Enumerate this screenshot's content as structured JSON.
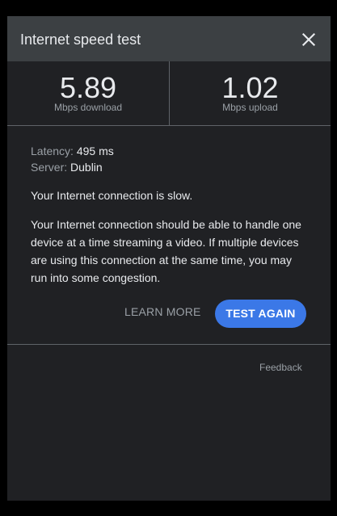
{
  "header": {
    "title": "Internet speed test",
    "close_icon": "close-icon"
  },
  "results": {
    "download": {
      "value": "5.89",
      "unit": "Mbps download"
    },
    "upload": {
      "value": "1.02",
      "unit": "Mbps upload"
    }
  },
  "details": {
    "latency_label": "Latency:",
    "latency_value": "495 ms",
    "server_label": "Server:",
    "server_value": "Dublin",
    "status": "Your Internet connection is slow.",
    "description": "Your Internet connection should be able to handle one device at a time streaming a video. If multiple devices are using this connection at the same time, you may run into some congestion."
  },
  "actions": {
    "learn_more": "LEARN MORE",
    "test_again": "TEST AGAIN"
  },
  "footer": {
    "feedback": "Feedback"
  },
  "colors": {
    "background": "#202124",
    "header": "#3c4043",
    "accent": "#3b78e7",
    "text": "#e8eaed",
    "muted_text": "#9aa0a6"
  }
}
